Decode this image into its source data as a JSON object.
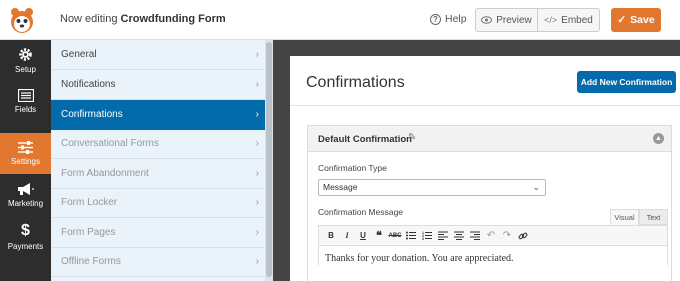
{
  "header": {
    "editing_prefix": "Now editing",
    "form_name": "Crowdfunding Form",
    "help_label": "Help",
    "preview_label": "Preview",
    "embed_label": "Embed",
    "save_label": "Save"
  },
  "sidebar": {
    "items": [
      {
        "label": "Setup",
        "icon": "gear-icon"
      },
      {
        "label": "Fields",
        "icon": "fields-icon"
      },
      {
        "label": "Settings",
        "icon": "sliders-icon",
        "active": true
      },
      {
        "label": "Marketing",
        "icon": "megaphone-icon"
      },
      {
        "label": "Payments",
        "icon": "dollar-icon"
      }
    ]
  },
  "settings_panel": {
    "items": [
      {
        "label": "General"
      },
      {
        "label": "Notifications"
      },
      {
        "label": "Confirmations",
        "active": true
      },
      {
        "label": "Conversational Forms"
      },
      {
        "label": "Form Abandonment"
      },
      {
        "label": "Form Locker"
      },
      {
        "label": "Form Pages"
      },
      {
        "label": "Offline Forms"
      }
    ]
  },
  "main": {
    "title": "Confirmations",
    "add_button": "Add New Confirmation",
    "confirmation": {
      "title": "Default Confirmation",
      "type_label": "Confirmation Type",
      "type_value": "Message",
      "message_label": "Confirmation Message",
      "tab_visual": "Visual",
      "tab_text": "Text",
      "message_text": "Thanks for your donation. You are appreciated."
    }
  },
  "colors": {
    "accent_orange": "#e27730",
    "primary_blue": "#036aab",
    "sidebar_dark": "#2d2d2d"
  }
}
